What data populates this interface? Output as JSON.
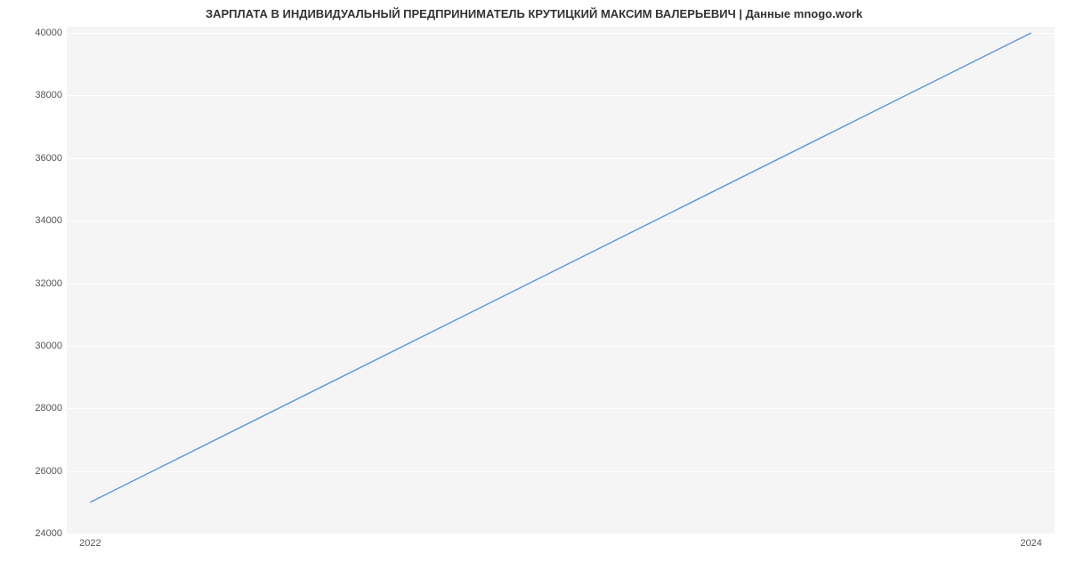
{
  "chart_data": {
    "type": "line",
    "title": "ЗАРПЛАТА В ИНДИВИДУАЛЬНЫЙ ПРЕДПРИНИМАТЕЛЬ КРУТИЦКИЙ МАКСИМ ВАЛЕРЬЕВИЧ | Данные mnogo.work",
    "x": [
      2022,
      2024
    ],
    "values": [
      25000,
      40000
    ],
    "xlabel": "",
    "ylabel": "",
    "x_ticks": [
      2022,
      2024
    ],
    "y_ticks": [
      24000,
      26000,
      28000,
      30000,
      32000,
      34000,
      36000,
      38000,
      40000
    ],
    "ylim": [
      24000,
      40200
    ],
    "xlim": [
      2021.95,
      2024.05
    ],
    "grid": true,
    "line_color": "#6699dd"
  }
}
